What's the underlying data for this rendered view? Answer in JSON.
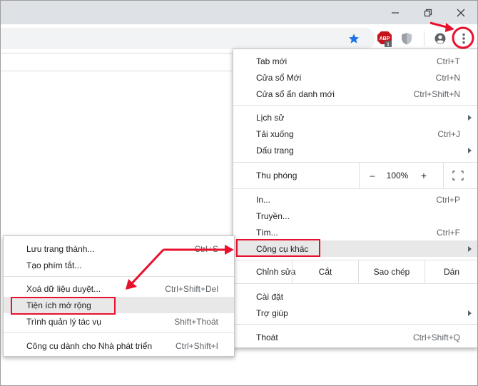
{
  "window": {
    "controls": [
      "minimize",
      "restore",
      "close"
    ]
  },
  "toolbar": {
    "icons": [
      "star-icon",
      "adblock-icon",
      "shield-extension-icon",
      "profile-icon",
      "kebab-menu-icon"
    ],
    "adblock_text": "ABP",
    "adblock_badge": "1"
  },
  "main_menu": {
    "items": [
      {
        "label": "Tab mới",
        "shortcut": "Ctrl+T"
      },
      {
        "label": "Cửa sổ Mới",
        "shortcut": "Ctrl+N"
      },
      {
        "label": "Cửa sổ ẩn danh mới",
        "shortcut": "Ctrl+Shift+N"
      },
      {
        "label": "Lịch sử",
        "shortcut": ""
      },
      {
        "label": "Tải xuống",
        "shortcut": "Ctrl+J"
      },
      {
        "label": "Dấu trang",
        "shortcut": ""
      },
      {
        "label": "In...",
        "shortcut": "Ctrl+P"
      },
      {
        "label": "Truyền...",
        "shortcut": ""
      },
      {
        "label": "Tìm...",
        "shortcut": "Ctrl+F"
      },
      {
        "label": "Công cụ khác",
        "shortcut": ""
      },
      {
        "label": "Cài đặt",
        "shortcut": ""
      },
      {
        "label": "Trợ giúp",
        "shortcut": ""
      },
      {
        "label": "Thoát",
        "shortcut": "Ctrl+Shift+Q"
      }
    ],
    "zoom": {
      "label": "Thu phóng",
      "minus": "–",
      "value": "100%",
      "plus": "+"
    },
    "edit": {
      "label": "Chỉnh sửa",
      "cut": "Cắt",
      "copy": "Sao chép",
      "paste": "Dán"
    }
  },
  "sub_menu": {
    "items": [
      {
        "label": "Lưu trang thành...",
        "shortcut": "Ctrl+S"
      },
      {
        "label": "Tạo phím tắt...",
        "shortcut": ""
      },
      {
        "label": "Xoá dữ liệu duyệt...",
        "shortcut": "Ctrl+Shift+Del"
      },
      {
        "label": "Tiện ích mở rộng",
        "shortcut": ""
      },
      {
        "label": "Trình quản lý tác vụ",
        "shortcut": "Shift+Thoát"
      },
      {
        "label": "Công cụ dành cho Nhà phát triển",
        "shortcut": "Ctrl+Shift+I"
      }
    ]
  },
  "colors": {
    "annotation_red": "#e8112d",
    "star_blue": "#1a73e8",
    "titlebar": "#dee1e6"
  }
}
